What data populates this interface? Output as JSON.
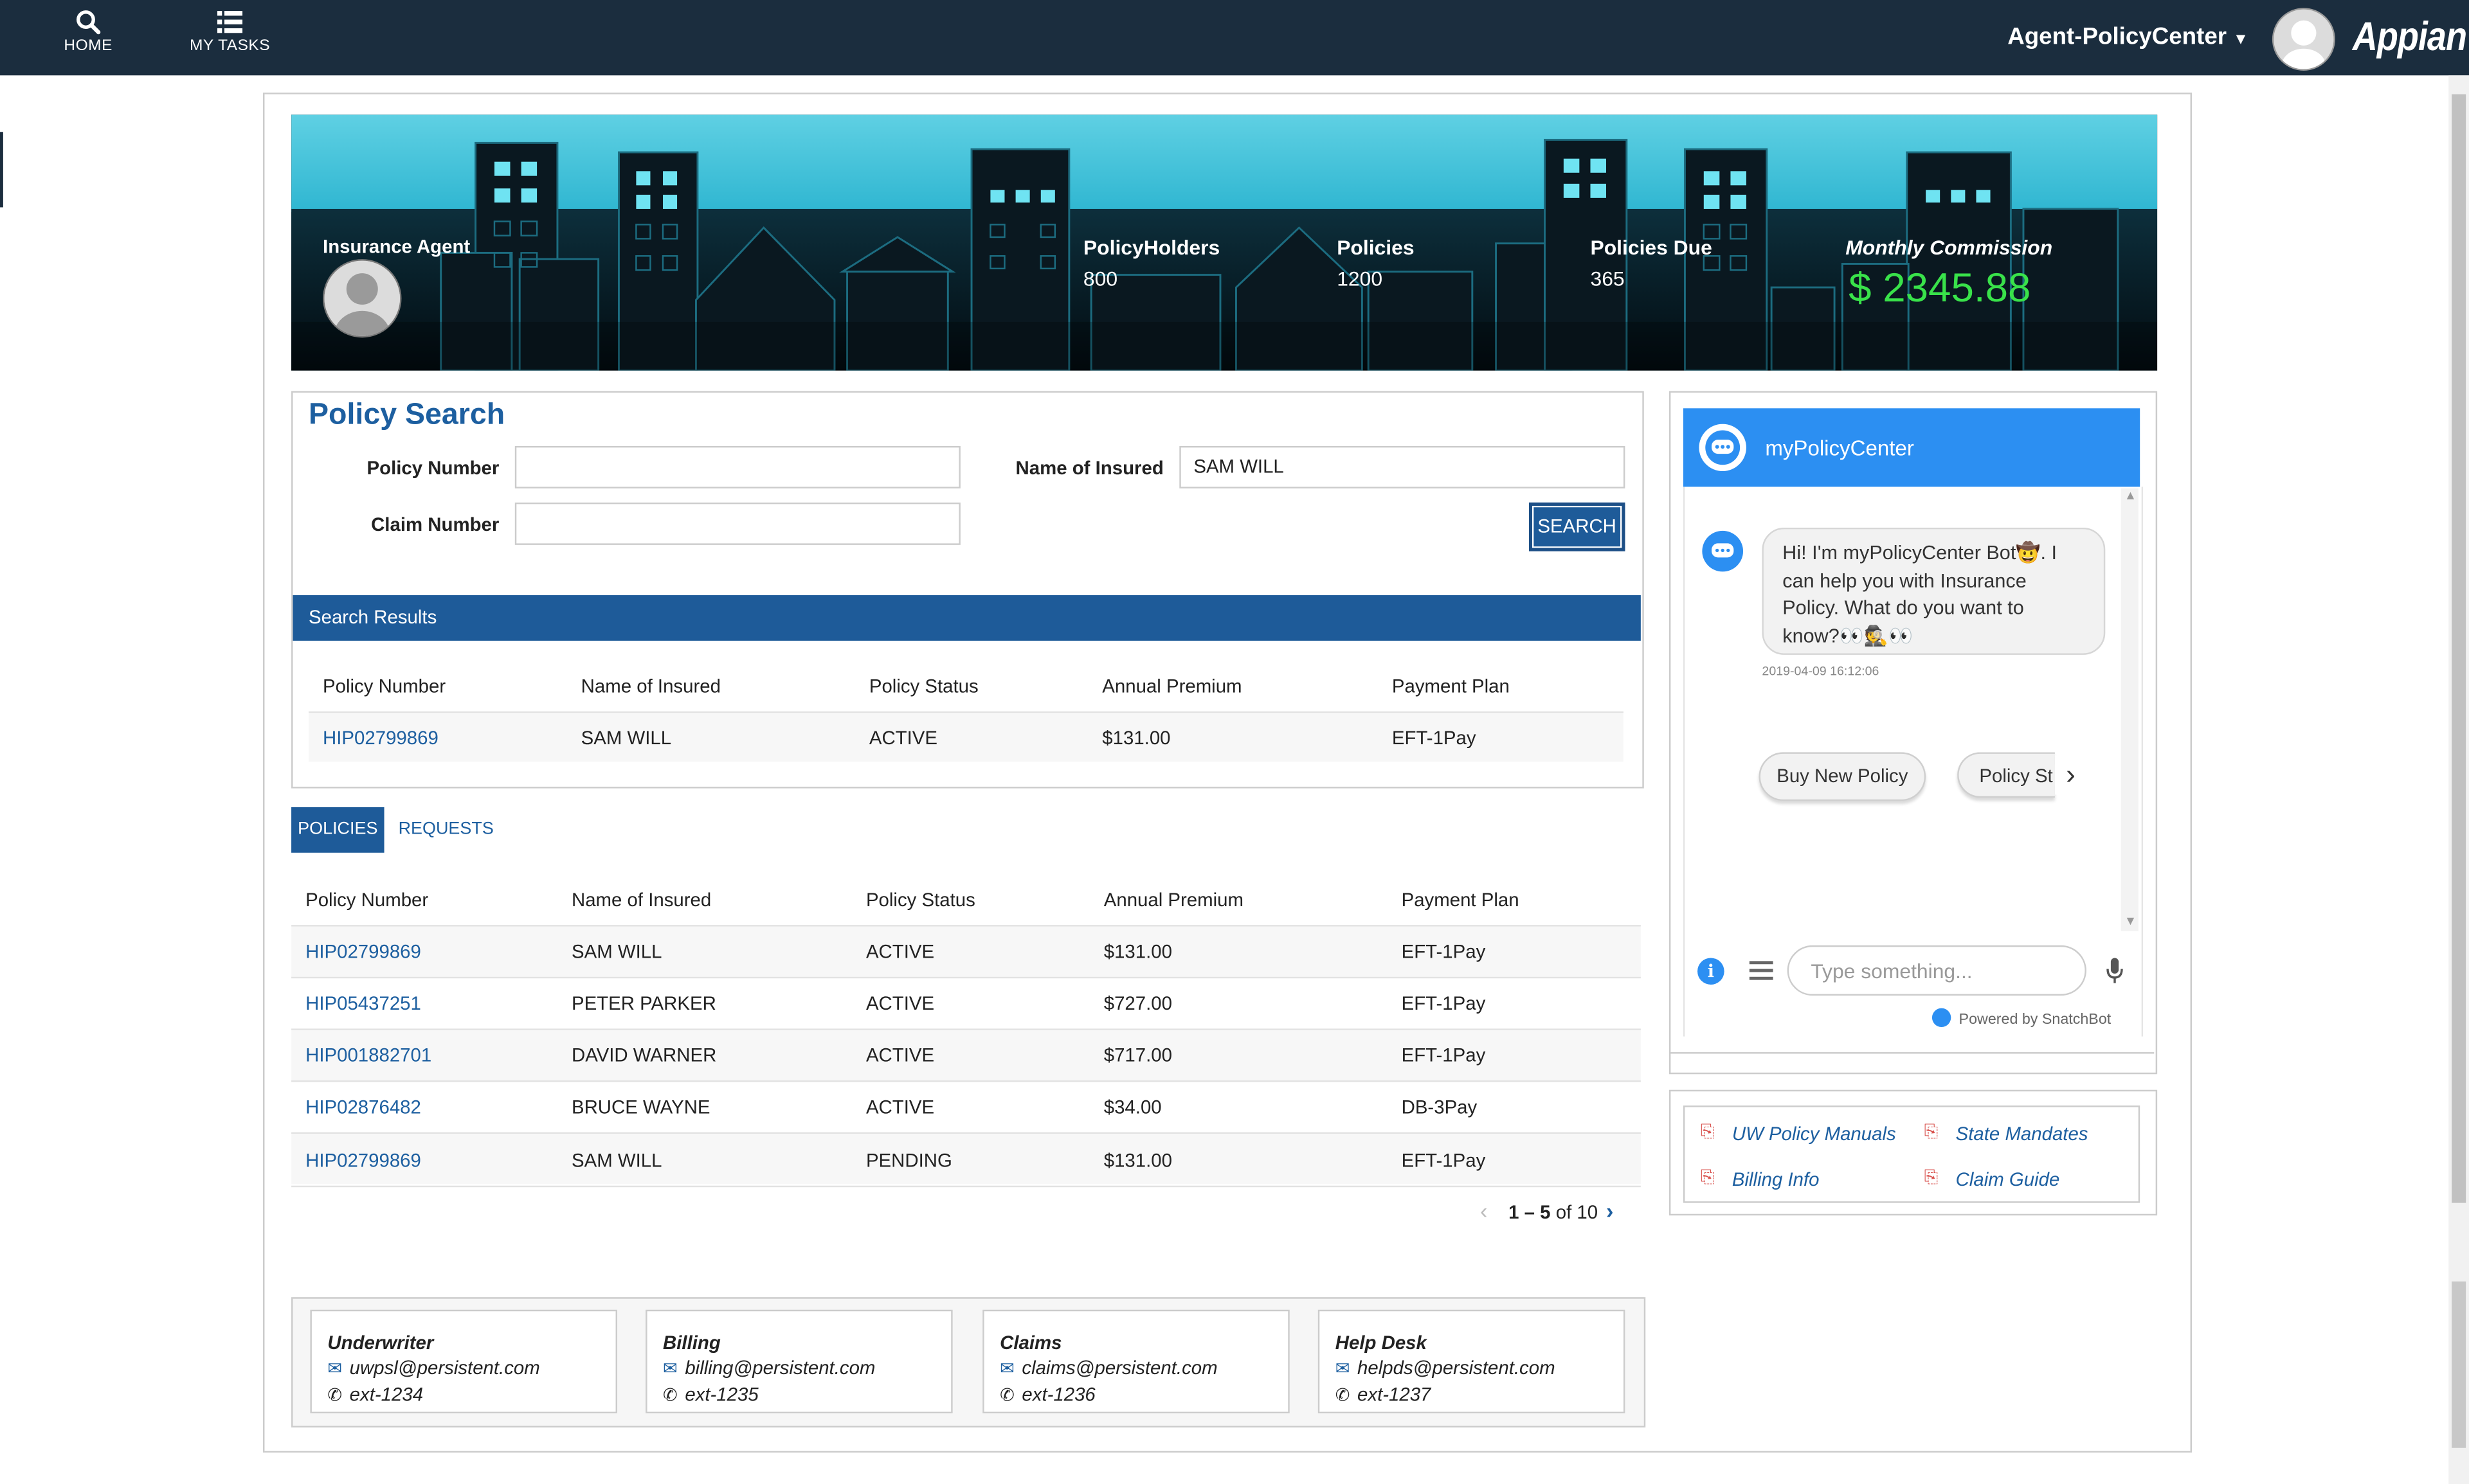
{
  "nav": {
    "home_label": "HOME",
    "tasks_label": "MY TASKS",
    "site_name": "Agent-PolicyCenter",
    "logo_text": "Appian"
  },
  "banner": {
    "agent_label": "Insurance Agent",
    "stats": [
      {
        "label": "PolicyHolders",
        "value": "800"
      },
      {
        "label": "Policies",
        "value": "1200"
      },
      {
        "label": "Policies Due",
        "value": "365"
      }
    ],
    "commission_label": "Monthly Commission",
    "commission_value": "$ 2345.88"
  },
  "search": {
    "title": "Policy Search",
    "policy_number_label": "Policy Number",
    "policy_number_value": "",
    "claim_number_label": "Claim Number",
    "claim_number_value": "",
    "name_label": "Name of Insured",
    "name_value": "SAM WILL",
    "button_label": "SEARCH",
    "results_title": "Search Results",
    "columns": [
      "Policy Number",
      "Name of Insured",
      "Policy Status",
      "Annual Premium",
      "Payment Plan"
    ],
    "rows": [
      [
        "HIP02799869",
        "SAM WILL",
        "ACTIVE",
        "$131.00",
        "EFT-1Pay"
      ]
    ]
  },
  "tabs": {
    "policies": "POLICIES",
    "requests": "REQUESTS"
  },
  "policies": {
    "columns": [
      "Policy Number",
      "Name of Insured",
      "Policy Status",
      "Annual Premium",
      "Payment Plan"
    ],
    "rows": [
      [
        "HIP02799869",
        "SAM WILL",
        "ACTIVE",
        "$131.00",
        "EFT-1Pay"
      ],
      [
        "HIP05437251",
        "PETER PARKER",
        "ACTIVE",
        "$727.00",
        "EFT-1Pay"
      ],
      [
        "HIP001882701",
        "DAVID WARNER",
        "ACTIVE",
        "$717.00",
        "EFT-1Pay"
      ],
      [
        "HIP02876482",
        "BRUCE WAYNE",
        "ACTIVE",
        "$34.00",
        "DB-3Pay"
      ],
      [
        "HIP02799869",
        "SAM WILL",
        "PENDING",
        "$131.00",
        "EFT-1Pay"
      ]
    ],
    "pagination_range": "1 – 5",
    "pagination_total": "of 10"
  },
  "chat": {
    "title": "myPolicyCenter",
    "message": "Hi! I'm myPolicyCenter Bot🤠. I can help you with Insurance Policy. What do you want to know?👀🕵👀",
    "timestamp": "2019-04-09 16:12:06",
    "chips": [
      "Buy New Policy",
      "Policy St"
    ],
    "input_placeholder": "Type something...",
    "powered_by": "Powered by SnatchBot"
  },
  "resources": {
    "links": [
      "UW Policy Manuals",
      "State Mandates",
      "Billing Info",
      "Claim Guide"
    ]
  },
  "contacts": [
    {
      "title": "Underwriter",
      "email": "uwpsl@persistent.com",
      "phone": "ext-1234"
    },
    {
      "title": "Billing",
      "email": "billing@persistent.com",
      "phone": "ext-1235"
    },
    {
      "title": "Claims",
      "email": "claims@persistent.com",
      "phone": "ext-1236"
    },
    {
      "title": "Help Desk",
      "email": "helpds@persistent.com",
      "phone": "ext-1237"
    }
  ],
  "colors": {
    "topbar": "#1b2d3e",
    "accent_blue": "#1e5b99",
    "chat_header": "#2c8ff2",
    "commission_green": "#39e24a"
  }
}
